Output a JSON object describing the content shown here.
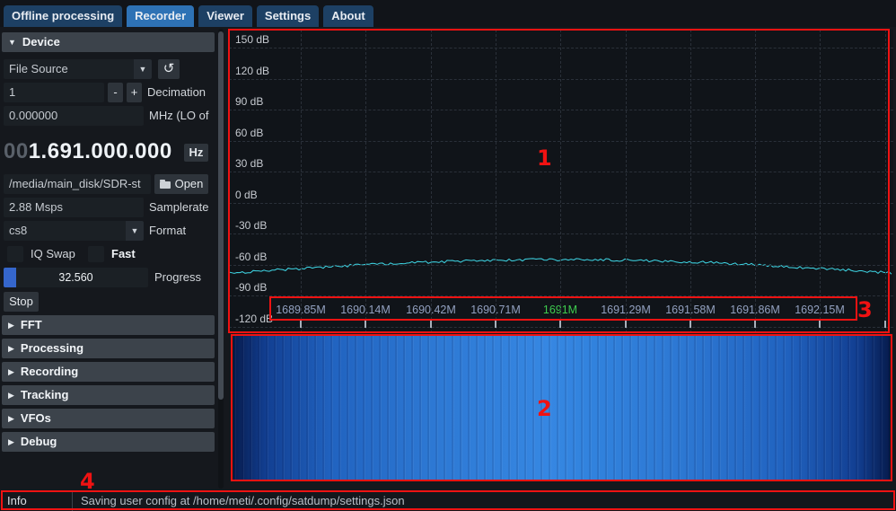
{
  "tabs": [
    {
      "label": "Offline processing",
      "active": false
    },
    {
      "label": "Recorder",
      "active": true
    },
    {
      "label": "Viewer",
      "active": false
    },
    {
      "label": "Settings",
      "active": false
    },
    {
      "label": "About",
      "active": false
    }
  ],
  "sidebar": {
    "device_section": {
      "arrow": "▼",
      "label": "Device"
    },
    "source_combo": {
      "value": "File Source",
      "arrow": "▼"
    },
    "refresh_button": "↺",
    "decimation": {
      "value": "1",
      "minus_label": "-",
      "plus_label": "+",
      "label": "Decimation"
    },
    "lo_offset": {
      "value": "0.000000",
      "label": "MHz (LO of"
    },
    "frequency_display": {
      "dim_digits": "00",
      "digits": "1.691.000.000",
      "unit_button": "Hz"
    },
    "file_input": {
      "value": "/media/main_disk/SDR-st",
      "open_button": "Open"
    },
    "samplerate": {
      "value": "2.88 Msps",
      "label": "Samplerate"
    },
    "format_combo": {
      "value": "cs8",
      "arrow": "▼",
      "label": "Format"
    },
    "iq_swap": {
      "label": "IQ Swap",
      "checked": false
    },
    "fast": {
      "label": "Fast",
      "checked": false
    },
    "progress": {
      "value": "32.560",
      "label": "Progress",
      "fraction": 0.09
    },
    "stop_button": "Stop",
    "collapsed_sections": [
      {
        "arrow": "▶",
        "label": "FFT"
      },
      {
        "arrow": "▶",
        "label": "Processing"
      },
      {
        "arrow": "▶",
        "label": "Recording"
      },
      {
        "arrow": "▶",
        "label": "Tracking"
      },
      {
        "arrow": "▶",
        "label": "VFOs"
      },
      {
        "arrow": "▶",
        "label": "Debug"
      }
    ]
  },
  "fft": {
    "db_labels": [
      "150 dB",
      "120 dB",
      "90 dB",
      "60 dB",
      "30 dB",
      "0 dB",
      "-30 dB",
      "-60 dB",
      "-90 dB",
      "-120 dB"
    ],
    "freq_labels": [
      {
        "text": "1689.85M",
        "highlight": false
      },
      {
        "text": "1690.14M",
        "highlight": false
      },
      {
        "text": "1690.42M",
        "highlight": false
      },
      {
        "text": "1690.71M",
        "highlight": false
      },
      {
        "text": "1691M",
        "highlight": true
      },
      {
        "text": "1691.29M",
        "highlight": false
      },
      {
        "text": "1691.58M",
        "highlight": false
      },
      {
        "text": "1691.86M",
        "highlight": false
      },
      {
        "text": "1692.15M",
        "highlight": false
      }
    ],
    "spectrum": {
      "approx_edge_db": -70,
      "approx_peak_db": -62,
      "line_color": "#3fd9e8"
    }
  },
  "annotations": {
    "color": "#f01212",
    "labels": [
      "1",
      "2",
      "3",
      "4"
    ]
  },
  "status_bar": {
    "left_label": "Info",
    "message": "Saving user config at /home/meti/.config/satdump/settings.json"
  }
}
